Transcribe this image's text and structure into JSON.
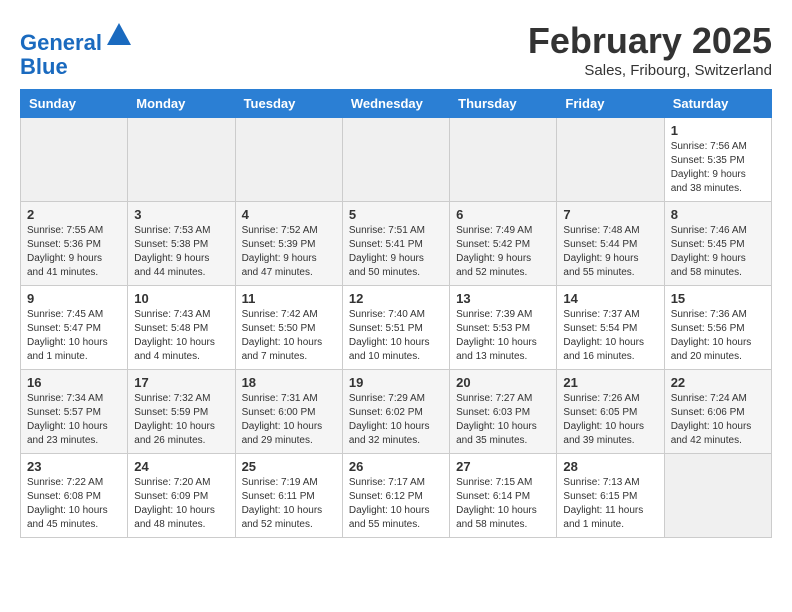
{
  "header": {
    "logo_line1": "General",
    "logo_line2": "Blue",
    "month_title": "February 2025",
    "location": "Sales, Fribourg, Switzerland"
  },
  "days_of_week": [
    "Sunday",
    "Monday",
    "Tuesday",
    "Wednesday",
    "Thursday",
    "Friday",
    "Saturday"
  ],
  "weeks": [
    [
      {
        "day": "",
        "info": ""
      },
      {
        "day": "",
        "info": ""
      },
      {
        "day": "",
        "info": ""
      },
      {
        "day": "",
        "info": ""
      },
      {
        "day": "",
        "info": ""
      },
      {
        "day": "",
        "info": ""
      },
      {
        "day": "1",
        "info": "Sunrise: 7:56 AM\nSunset: 5:35 PM\nDaylight: 9 hours and 38 minutes."
      }
    ],
    [
      {
        "day": "2",
        "info": "Sunrise: 7:55 AM\nSunset: 5:36 PM\nDaylight: 9 hours and 41 minutes."
      },
      {
        "day": "3",
        "info": "Sunrise: 7:53 AM\nSunset: 5:38 PM\nDaylight: 9 hours and 44 minutes."
      },
      {
        "day": "4",
        "info": "Sunrise: 7:52 AM\nSunset: 5:39 PM\nDaylight: 9 hours and 47 minutes."
      },
      {
        "day": "5",
        "info": "Sunrise: 7:51 AM\nSunset: 5:41 PM\nDaylight: 9 hours and 50 minutes."
      },
      {
        "day": "6",
        "info": "Sunrise: 7:49 AM\nSunset: 5:42 PM\nDaylight: 9 hours and 52 minutes."
      },
      {
        "day": "7",
        "info": "Sunrise: 7:48 AM\nSunset: 5:44 PM\nDaylight: 9 hours and 55 minutes."
      },
      {
        "day": "8",
        "info": "Sunrise: 7:46 AM\nSunset: 5:45 PM\nDaylight: 9 hours and 58 minutes."
      }
    ],
    [
      {
        "day": "9",
        "info": "Sunrise: 7:45 AM\nSunset: 5:47 PM\nDaylight: 10 hours and 1 minute."
      },
      {
        "day": "10",
        "info": "Sunrise: 7:43 AM\nSunset: 5:48 PM\nDaylight: 10 hours and 4 minutes."
      },
      {
        "day": "11",
        "info": "Sunrise: 7:42 AM\nSunset: 5:50 PM\nDaylight: 10 hours and 7 minutes."
      },
      {
        "day": "12",
        "info": "Sunrise: 7:40 AM\nSunset: 5:51 PM\nDaylight: 10 hours and 10 minutes."
      },
      {
        "day": "13",
        "info": "Sunrise: 7:39 AM\nSunset: 5:53 PM\nDaylight: 10 hours and 13 minutes."
      },
      {
        "day": "14",
        "info": "Sunrise: 7:37 AM\nSunset: 5:54 PM\nDaylight: 10 hours and 16 minutes."
      },
      {
        "day": "15",
        "info": "Sunrise: 7:36 AM\nSunset: 5:56 PM\nDaylight: 10 hours and 20 minutes."
      }
    ],
    [
      {
        "day": "16",
        "info": "Sunrise: 7:34 AM\nSunset: 5:57 PM\nDaylight: 10 hours and 23 minutes."
      },
      {
        "day": "17",
        "info": "Sunrise: 7:32 AM\nSunset: 5:59 PM\nDaylight: 10 hours and 26 minutes."
      },
      {
        "day": "18",
        "info": "Sunrise: 7:31 AM\nSunset: 6:00 PM\nDaylight: 10 hours and 29 minutes."
      },
      {
        "day": "19",
        "info": "Sunrise: 7:29 AM\nSunset: 6:02 PM\nDaylight: 10 hours and 32 minutes."
      },
      {
        "day": "20",
        "info": "Sunrise: 7:27 AM\nSunset: 6:03 PM\nDaylight: 10 hours and 35 minutes."
      },
      {
        "day": "21",
        "info": "Sunrise: 7:26 AM\nSunset: 6:05 PM\nDaylight: 10 hours and 39 minutes."
      },
      {
        "day": "22",
        "info": "Sunrise: 7:24 AM\nSunset: 6:06 PM\nDaylight: 10 hours and 42 minutes."
      }
    ],
    [
      {
        "day": "23",
        "info": "Sunrise: 7:22 AM\nSunset: 6:08 PM\nDaylight: 10 hours and 45 minutes."
      },
      {
        "day": "24",
        "info": "Sunrise: 7:20 AM\nSunset: 6:09 PM\nDaylight: 10 hours and 48 minutes."
      },
      {
        "day": "25",
        "info": "Sunrise: 7:19 AM\nSunset: 6:11 PM\nDaylight: 10 hours and 52 minutes."
      },
      {
        "day": "26",
        "info": "Sunrise: 7:17 AM\nSunset: 6:12 PM\nDaylight: 10 hours and 55 minutes."
      },
      {
        "day": "27",
        "info": "Sunrise: 7:15 AM\nSunset: 6:14 PM\nDaylight: 10 hours and 58 minutes."
      },
      {
        "day": "28",
        "info": "Sunrise: 7:13 AM\nSunset: 6:15 PM\nDaylight: 11 hours and 1 minute."
      },
      {
        "day": "",
        "info": ""
      }
    ]
  ]
}
